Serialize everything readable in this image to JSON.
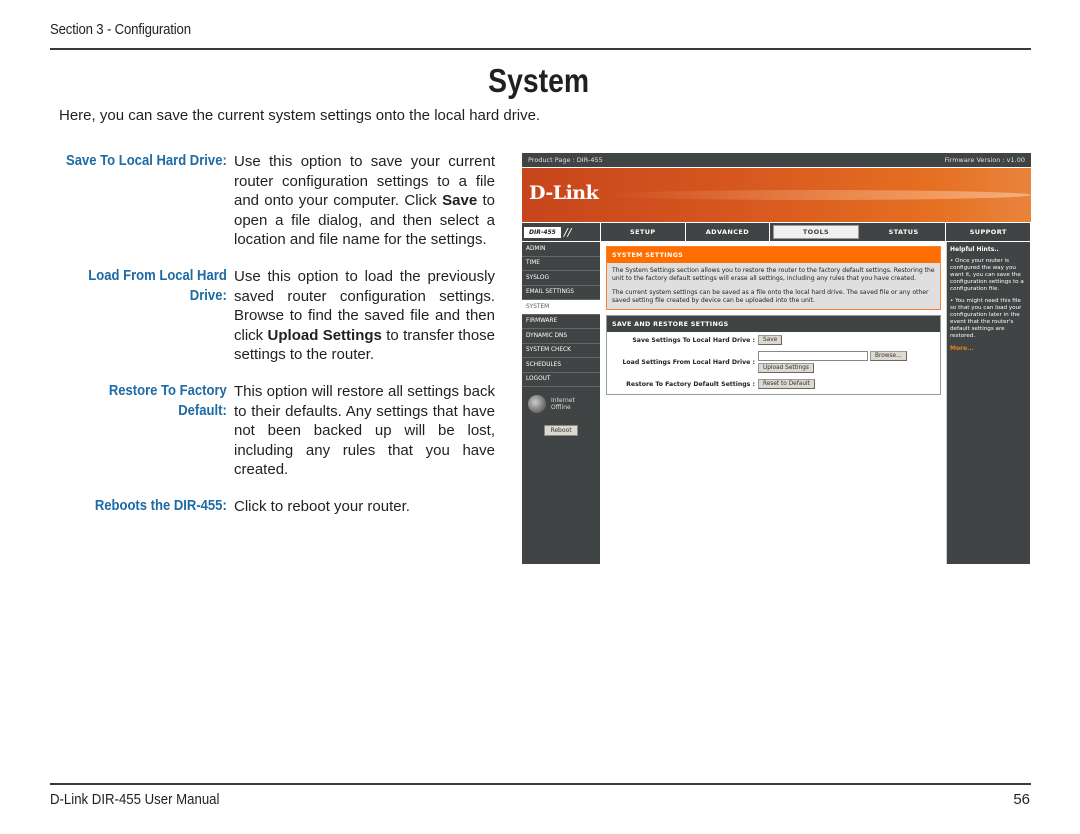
{
  "header": {
    "section": "Section 3 - Configuration"
  },
  "title": "System",
  "intro": "Here, you can save the current system settings onto the local hard drive.",
  "definitions": [
    {
      "term": "Save To Local Hard Drive:",
      "desc_pre": "Use this option to save your current router configuration settings to a file and onto your computer. Click ",
      "desc_bold": "Save",
      "desc_post": " to open a file dialog, and then select a location and file name for the settings."
    },
    {
      "term": "Load From Local Hard Drive:",
      "desc_pre": "Use this option to load the previously saved router configuration settings. Browse to find the saved file and then click ",
      "desc_bold": "Upload Settings",
      "desc_post": " to transfer those settings to the router."
    },
    {
      "term": "Restore To Factory Default:",
      "desc_pre": "This option will restore all settings back to their defaults. Any settings that have not been backed up will be lost, including any rules that you have created.",
      "desc_bold": "",
      "desc_post": ""
    },
    {
      "term": "Reboots the DIR-455:",
      "desc_pre": "Click to reboot your router.",
      "desc_bold": "",
      "desc_post": ""
    }
  ],
  "router": {
    "product_page": "Product Page :  DIR-455",
    "firmware": "Firmware Version : v1.00",
    "logo": "D-Link",
    "model_tag": "DIR-455",
    "tabs": [
      "SETUP",
      "ADVANCED",
      "TOOLS",
      "STATUS",
      "SUPPORT"
    ],
    "active_tab": "TOOLS",
    "sidebar": [
      "ADMIN",
      "TIME",
      "SYSLOG",
      "EMAIL SETTINGS",
      "SYSTEM",
      "FIRMWARE",
      "DYNAMIC DNS",
      "SYSTEM CHECK",
      "SCHEDULES",
      "LOGOUT"
    ],
    "active_sidebar": "SYSTEM",
    "internet_status_line1": "Internet",
    "internet_status_line2": "Offline",
    "reboot_label": "Reboot",
    "system_settings": {
      "title": "SYSTEM SETTINGS",
      "para1": "The System Settings section allows you to restore the router to the factory default settings. Restoring the unit to the factory default settings will erase all settings, including any rules that you have created.",
      "para2": "The current system settings can be saved as a file onto the local hard drive. The saved file or any other saved setting file created by device can be uploaded into the unit."
    },
    "save_restore": {
      "title": "SAVE AND RESTORE SETTINGS",
      "save_label": "Save Settings To Local Hard Drive :",
      "save_button": "Save",
      "load_label": "Load Settings From Local Hard Drive :",
      "browse_button": "Browse...",
      "upload_button": "Upload Settings",
      "restore_label": "Restore To Factory Default Settings :",
      "restore_button": "Reset to Default"
    },
    "hints": {
      "title": "Helpful Hints..",
      "hint1": "• Once your router is configured the way you want it, you can save the configuration settings to a configuration file.",
      "hint2": "• You might need this file so that you can load your configuration later in the event that the router's default settings are restored.",
      "more": "More..."
    }
  },
  "footer": {
    "manual": "D-Link DIR-455 User Manual",
    "page": "56"
  }
}
